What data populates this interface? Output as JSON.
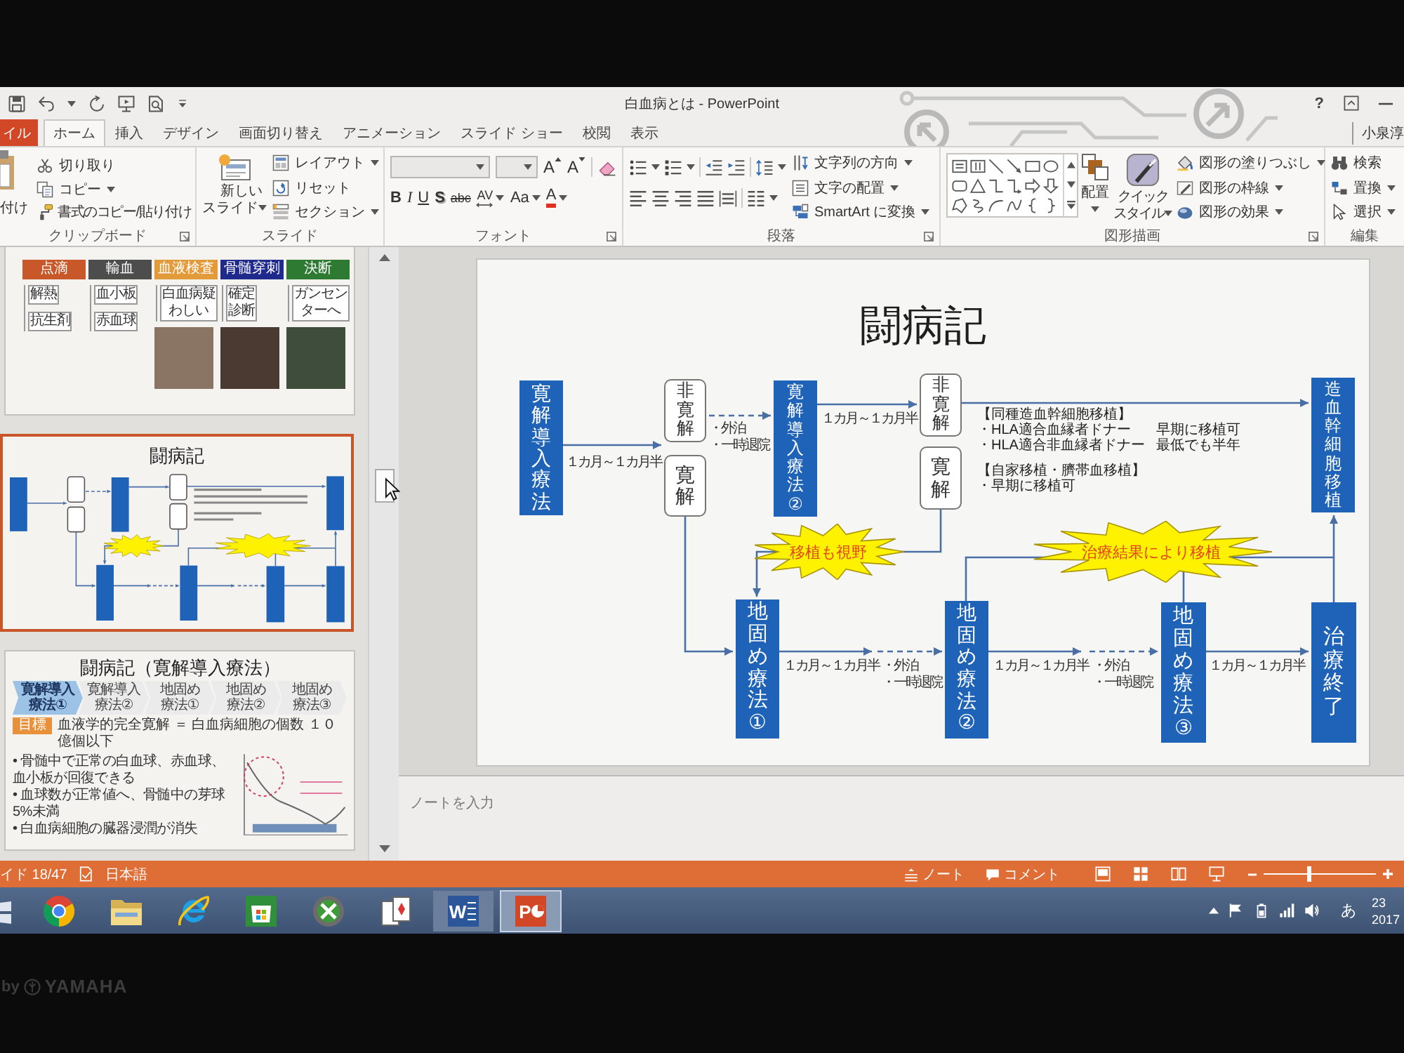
{
  "window": {
    "title": "白血病とは - PowerPoint",
    "help": "?",
    "user": "小泉淳"
  },
  "tabs": [
    {
      "label": "イル",
      "kind": "file",
      "selected": false
    },
    {
      "label": "ホーム",
      "kind": "tab",
      "selected": true
    },
    {
      "label": "挿入",
      "kind": "tab",
      "selected": false
    },
    {
      "label": "デザイン",
      "kind": "tab",
      "selected": false
    },
    {
      "label": "画面切り替え",
      "kind": "tab",
      "selected": false
    },
    {
      "label": "アニメーション",
      "kind": "tab",
      "selected": false
    },
    {
      "label": "スライド ショー",
      "kind": "tab",
      "selected": false
    },
    {
      "label": "校閲",
      "kind": "tab",
      "selected": false
    },
    {
      "label": "表示",
      "kind": "tab",
      "selected": false
    }
  ],
  "ribbon": {
    "clipboard": {
      "label": "クリップボード",
      "paste": "付け",
      "cut": "切り取り",
      "copy": "コピー",
      "format_painter": "書式のコピー/貼り付け"
    },
    "slides": {
      "label": "スライド",
      "new_slide": "新しいスライド",
      "layout": "レイアウト",
      "reset": "リセット",
      "section": "セクション"
    },
    "font": {
      "label": "フォント",
      "size_buttons": [
        {
          "label": "A",
          "kind": "grow"
        },
        {
          "label": "A",
          "kind": "shrink"
        }
      ],
      "style_buttons": [
        {
          "label": "B",
          "kind": "bold"
        },
        {
          "label": "I",
          "kind": "italic"
        },
        {
          "label": "U",
          "kind": "underline"
        },
        {
          "label": "S",
          "kind": "shadow"
        },
        {
          "label": "abc",
          "kind": "strike"
        },
        {
          "label": "AV",
          "kind": "spacing"
        },
        {
          "label": "Aa",
          "kind": "case"
        },
        {
          "label": "A",
          "kind": "color"
        }
      ]
    },
    "paragraph": {
      "label": "段落",
      "text_direction": "文字列の方向",
      "align_text": "文字の配置",
      "smartart": "SmartArt に変換"
    },
    "drawing": {
      "label": "図形描画",
      "arrange": "配置",
      "quick_styles": "クイックスタイル",
      "fill": "図形の塗りつぶし",
      "outline": "図形の枠線",
      "effects": "図形の効果"
    },
    "editing": {
      "label": "編集",
      "find": "検索",
      "replace": "置換",
      "select": "選択"
    }
  },
  "thumbnails": [
    {
      "kind": "tags",
      "selected": false,
      "columns": [
        {
          "tag": "点滴",
          "color": "#c8582a",
          "items": [
            "解熱",
            "抗生剤"
          ],
          "photo": false
        },
        {
          "tag": "輸血",
          "color": "#4d4d4d",
          "items": [
            "血小板",
            "赤血球"
          ],
          "photo": false
        },
        {
          "tag": "血液検査",
          "color": "#e39a3b",
          "items": [
            "白血病疑わしい"
          ],
          "photo": true
        },
        {
          "tag": "骨髄穿刺",
          "color": "#1f2a8c",
          "items": [
            "確定診断"
          ],
          "photo": true
        },
        {
          "tag": "決断",
          "color": "#2e7a33",
          "items": [
            "ガンセンターへ"
          ],
          "photo": true
        }
      ]
    },
    {
      "kind": "diagram",
      "selected": true,
      "title": "闘病記"
    },
    {
      "kind": "steps",
      "selected": false,
      "title": "闘病記（寛解導入療法）",
      "steps": [
        {
          "label": "寛解導入療法①",
          "selected": true
        },
        {
          "label": "寛解導入療法②",
          "selected": false
        },
        {
          "label": "地固め療法①",
          "selected": false
        },
        {
          "label": "地固め療法②",
          "selected": false
        },
        {
          "label": "地固め療法③",
          "selected": false
        }
      ],
      "goal_tag": "目標",
      "goal": "血液学的完全寛解 ＝ 白血病細胞の個数 １０億個以下",
      "bullets": [
        "• 骨髄中で正常の白血球、赤血球、血小板が回復できる",
        "• 血球数が正常値へ、骨髄中の芽球5%未満",
        "• 白血病細胞の臓器浸潤が消失"
      ]
    }
  ],
  "slide": {
    "title": "闘病記",
    "boxes": [
      {
        "kind": "phase",
        "text": "寛解導入療法"
      },
      {
        "kind": "outcome",
        "text": "非寛解"
      },
      {
        "kind": "outcome",
        "text": "寛解"
      },
      {
        "kind": "phase",
        "text": "寛解導入療法②"
      },
      {
        "kind": "outcome",
        "text": "非寛解"
      },
      {
        "kind": "outcome",
        "text": "寛解"
      },
      {
        "kind": "phase",
        "text": "造血幹細胞移植"
      },
      {
        "kind": "phase",
        "text": "地固め療法①"
      },
      {
        "kind": "phase",
        "text": "地固め療法②"
      },
      {
        "kind": "phase",
        "text": "地固め療法③"
      },
      {
        "kind": "phase",
        "text": "治療終了"
      }
    ],
    "durations": [
      "１カ月～１カ月半",
      "１カ月～１カ月半",
      "１カ月～１カ月半",
      "１カ月～１カ月半",
      "１カ月～１カ月半"
    ],
    "leaves": [
      {
        "lines": [
          "・外泊",
          "・一時退院"
        ]
      },
      {
        "lines": [
          "・外泊",
          "・一時退院"
        ]
      },
      {
        "lines": [
          "・外泊",
          "・一時退院"
        ]
      }
    ],
    "transplant_info": {
      "sections": [
        {
          "heading": "【同種造血幹細胞移植】",
          "rows": [
            {
              "donor": "・HLA適合血縁者ドナー",
              "timing": "早期に移植可"
            },
            {
              "donor": "・HLA適合非血縁者ドナー",
              "timing": "最低でも半年"
            }
          ]
        },
        {
          "heading": "【自家移植・臍帯血移植】",
          "rows": [
            {
              "donor": "・早期に移植可"
            }
          ]
        }
      ]
    },
    "callouts": [
      "移植も視野",
      "治療結果により移植"
    ]
  },
  "notes": {
    "placeholder": "ノートを入力"
  },
  "status_bar": {
    "slide_counter": "イド 18/47",
    "language": "日本語",
    "notes": "ノート",
    "comments": "コメント",
    "zoom": {
      "level": 0.4
    }
  },
  "taskbar": {
    "apps": [
      {
        "kind": "chrome",
        "running": false,
        "active": false
      },
      {
        "kind": "explorer",
        "running": false,
        "active": false
      },
      {
        "kind": "ie",
        "running": false,
        "active": false
      },
      {
        "kind": "store",
        "running": false,
        "active": false
      },
      {
        "kind": "xbox",
        "running": false,
        "active": false
      },
      {
        "kind": "cards",
        "running": false,
        "active": false
      },
      {
        "kind": "word",
        "letter": "W",
        "running": true,
        "active": false
      },
      {
        "kind": "powerpoint",
        "letter": "P",
        "running": true,
        "active": true
      }
    ],
    "tray": {
      "ime": "あ",
      "time": "23",
      "date": "2017"
    }
  },
  "bezel": {
    "prefix": "by",
    "brand": "YAMAHA"
  }
}
